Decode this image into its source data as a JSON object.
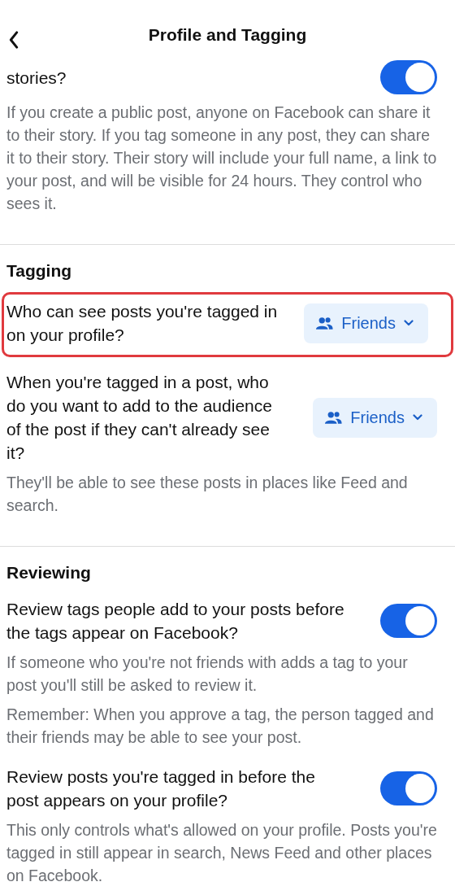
{
  "header": {
    "title": "Profile and Tagging"
  },
  "sections": [
    {
      "items": [
        {
          "kind": "toggle",
          "question": "stories?",
          "on": true,
          "highlighted": false,
          "notes": [
            "If you create a public post, anyone on Facebook can share it to their story. If you tag someone in any post, they can share it to their story. Their story will include your full name, a link to your post, and will be visible for 24 hours. They control who sees it."
          ]
        }
      ]
    },
    {
      "heading": "Tagging",
      "items": [
        {
          "kind": "audience",
          "question": "Who can see posts you're tagged in on your profile?",
          "audience": "Friends",
          "highlighted": true
        },
        {
          "kind": "audience",
          "question": "When you're tagged in a post, who do you want to add to the audience of the post if they can't already see it?",
          "audience": "Friends",
          "highlighted": false,
          "notes": [
            "They'll be able to see these posts in places like Feed and search."
          ]
        }
      ]
    },
    {
      "heading": "Reviewing",
      "items": [
        {
          "kind": "toggle",
          "question": "Review tags people add to your posts before the tags appear on Facebook?",
          "on": true,
          "highlighted": false,
          "notes": [
            "If someone who you're not friends with adds a tag to your post you'll still be asked to review it.",
            "Remember: When you approve a tag, the person tagged and their friends may be able to see your post."
          ]
        },
        {
          "kind": "toggle",
          "question": "Review posts you're tagged in before the post appears on your profile?",
          "on": true,
          "highlighted": false,
          "notes": [
            "This only controls what's allowed on your profile. Posts you're tagged in still appear in search, News Feed and other places on Facebook."
          ]
        }
      ]
    }
  ]
}
